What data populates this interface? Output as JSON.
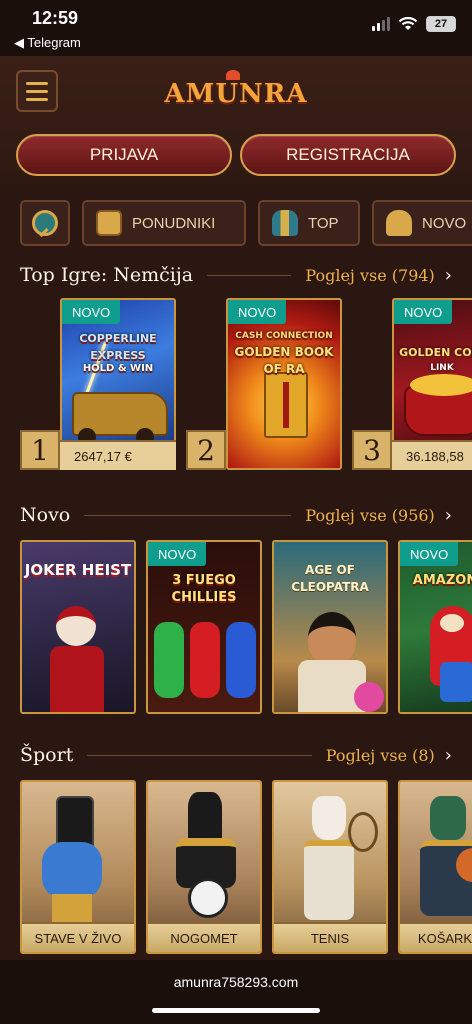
{
  "status_bar": {
    "time": "12:59",
    "back_app": "◀ Telegram",
    "battery": "27"
  },
  "header": {
    "logo_text": "AMUNRA",
    "login_label": "PRIJAVA",
    "register_label": "REGISTRACIJA"
  },
  "chips": [
    {
      "label": "",
      "icon": "search-icon"
    },
    {
      "label": "PONUDNIKI",
      "icon": "scroll-icon"
    },
    {
      "label": "TOP",
      "icon": "pharaoh-icon"
    },
    {
      "label": "NOVO",
      "icon": "bell-icon"
    }
  ],
  "sections": {
    "top": {
      "title": "Top Igre: Nemčija",
      "link": "Poglej vse (794)",
      "games": [
        {
          "badge": "NOVO",
          "title": "COPPERLINE EXPRESS",
          "subtitle": "HOLD & WIN",
          "rank": "1",
          "jackpot": "2647,17 €"
        },
        {
          "badge": "NOVO",
          "title": "GOLDEN BOOK OF RA",
          "subtitle": "CASH CONNECTION",
          "rank": "2",
          "jackpot": ""
        },
        {
          "badge": "NOVO",
          "title": "GOLDEN COIN",
          "subtitle": "LINK",
          "rank": "3",
          "jackpot": "36.188,58"
        }
      ]
    },
    "new": {
      "title": "Novo",
      "link": "Poglej vse (956)",
      "games": [
        {
          "badge": "",
          "title": "JOKER HEIST"
        },
        {
          "badge": "NOVO",
          "title": "3 FUEGO CHILLIES"
        },
        {
          "badge": "",
          "title": "AGE OF CLEOPATRA"
        },
        {
          "badge": "NOVO",
          "title": "AMAZON"
        }
      ]
    },
    "sport": {
      "title": "Šport",
      "link": "Poglej vse (8)",
      "items": [
        {
          "label": "STAVE V ŽIVO"
        },
        {
          "label": "NOGOMET"
        },
        {
          "label": "TENIS"
        },
        {
          "label": "KOŠARK"
        }
      ]
    }
  },
  "url_bar": {
    "url": "amunra758293.com"
  },
  "colors": {
    "accent_gold": "#f0b24a",
    "badge_teal": "#0f9d8e",
    "button_red": "#8f2a2a",
    "background": "#2a1712"
  }
}
